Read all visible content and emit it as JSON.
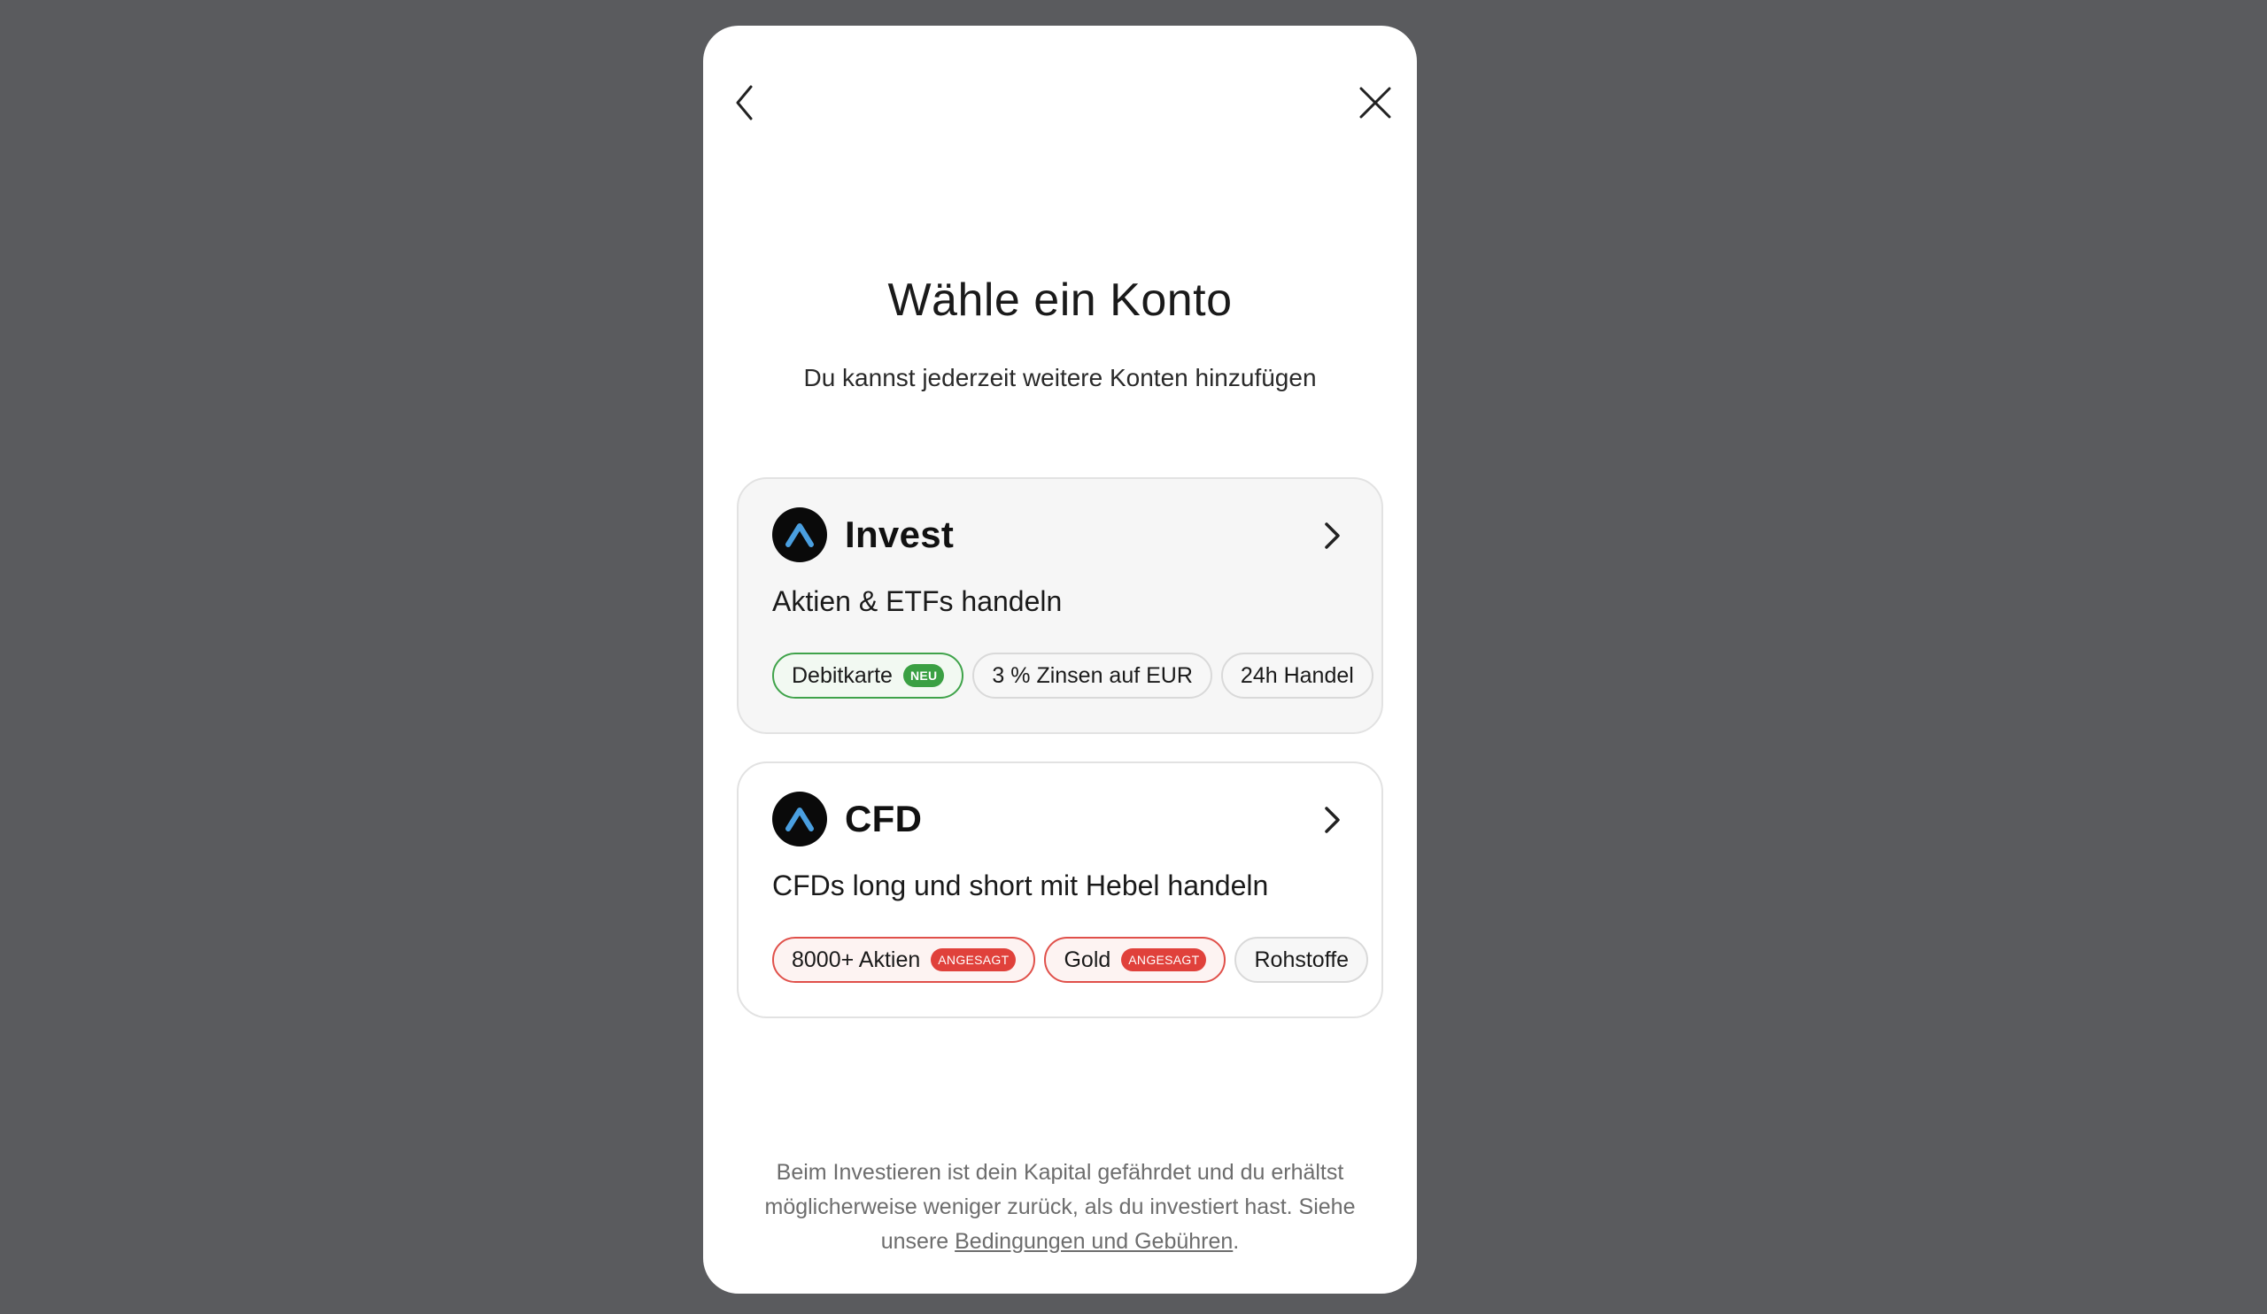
{
  "modal": {
    "title": "Wähle ein Konto",
    "subtitle": "Du kannst jederzeit weitere Konten hinzufügen"
  },
  "accounts": [
    {
      "name": "Invest",
      "description": "Aktien & ETFs handeln",
      "tags": [
        {
          "label": "Debitkarte",
          "badge": "NEU"
        },
        {
          "label": "3 % Zinsen auf EUR"
        },
        {
          "label": "24h Handel"
        }
      ]
    },
    {
      "name": "CFD",
      "description": "CFDs long und short mit Hebel handeln",
      "tags": [
        {
          "label": "8000+ Aktien",
          "badge": "ANGESAGT"
        },
        {
          "label": "Gold",
          "badge": "ANGESAGT"
        },
        {
          "label": "Rohstoffe"
        }
      ]
    }
  ],
  "disclaimer": {
    "text": "Beim Investieren ist dein Kapital gefährdet und du erhältst möglicherweise weniger zurück, als du investiert hast. Siehe unsere ",
    "link": "Bedingungen und Gebühren",
    "end": "."
  },
  "colors": {
    "backdrop": "#5a5b5e",
    "logo_bg": "#0a0a0a",
    "logo_accent": "#4a9fe0",
    "green": "#3aa043",
    "red": "#e0413b"
  },
  "icons": {
    "back": "chevron-left-icon",
    "close": "close-icon",
    "open": "chevron-right-icon",
    "logo": "brand-logo-icon"
  }
}
